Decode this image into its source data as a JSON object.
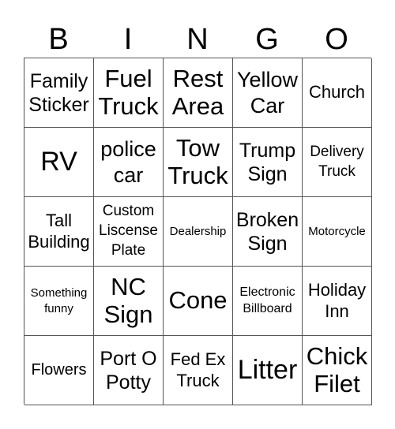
{
  "header": {
    "letters": [
      "B",
      "I",
      "N",
      "G",
      "O"
    ]
  },
  "card": {
    "rows": [
      [
        "Family Sticker",
        "Fuel Truck",
        "Rest Area",
        "Yellow Car",
        "Church"
      ],
      [
        "RV",
        "police car",
        "Tow Truck",
        "Trump Sign",
        "Delivery Truck"
      ],
      [
        "Tall Building",
        "Custom Liscense Plate",
        "Dealership",
        "Broken Sign",
        "Motorcycle"
      ],
      [
        "Something funny",
        "NC Sign",
        "Cone",
        "Electronic Billboard",
        "Holiday Inn"
      ],
      [
        "Flowers",
        "Port O Potty",
        "Fed Ex Truck",
        "Litter",
        "Chick Filet"
      ]
    ]
  }
}
